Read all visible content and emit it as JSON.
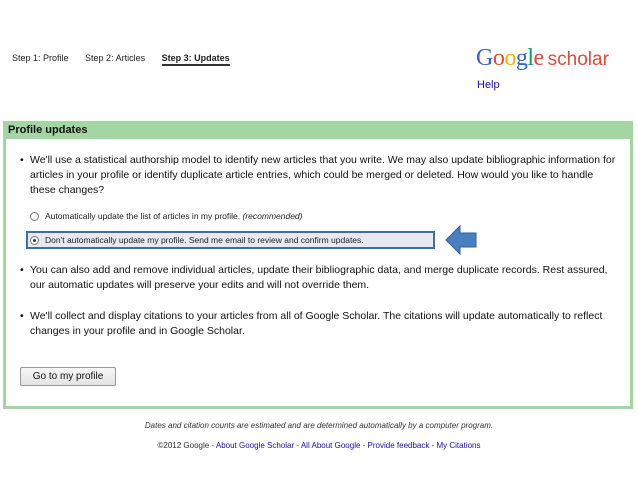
{
  "steps": [
    "Step 1: Profile",
    "Step 2: Articles",
    "Step 3: Updates"
  ],
  "logo": {
    "google_letters": [
      "G",
      "o",
      "o",
      "g",
      "l",
      "e"
    ],
    "google_colors": [
      "#3366cc",
      "#dd4b39",
      "#f4b400",
      "#3366cc",
      "#0f9d58",
      "#dd4b39"
    ],
    "scholar": "scholar"
  },
  "help": "Help",
  "panel": {
    "title": "Profile updates",
    "bullet1": "We'll use a statistical authorship model to identify new articles that you write. We may also update bibliographic information for articles in your profile or identify duplicate article entries, which could be merged or deleted. How would you like to handle these changes?",
    "option1": "Automatically update the list of articles in my profile.",
    "option1_note": "(recommended)",
    "option2": "Don't automatically update my profile. Send me email to review and confirm updates.",
    "bullet2": "You can also add and remove individual articles, update their bibliographic data, and merge duplicate records. Rest assured, our automatic updates will preserve your edits and will not override them.",
    "bullet3": "We'll collect and display citations to your articles from all of Google Scholar. The citations will update automatically to reflect changes in your profile and in Google Scholar.",
    "button": "Go to my profile"
  },
  "footnote": "Dates and citation counts are estimated and are determined automatically by a computer program.",
  "footer": {
    "copyright": "©2012 Google",
    "sep": " - ",
    "links": [
      "About Google Scholar",
      "All About Google",
      "Provide feedback",
      "My Citations"
    ]
  },
  "colors": {
    "panel_green": "#a3d6a3",
    "arrow_blue": "#4a7fc1",
    "link": "#1a0dab"
  }
}
